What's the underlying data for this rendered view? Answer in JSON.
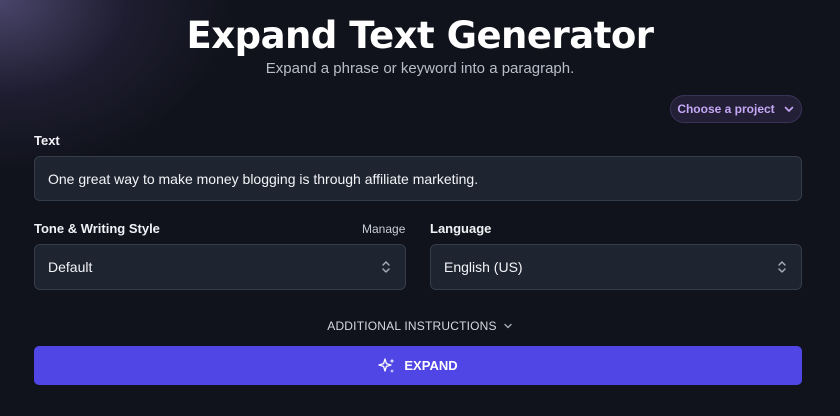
{
  "header": {
    "title": "Expand Text Generator",
    "subtitle": "Expand a phrase or keyword into a paragraph."
  },
  "project_selector": {
    "label": "Choose a project",
    "icon": "chevron-down-icon",
    "color": "#c4a8f5"
  },
  "text_field": {
    "label": "Text",
    "value": "One great way to make money blogging is through affiliate marketing."
  },
  "tone": {
    "label": "Tone & Writing Style",
    "manage_label": "Manage",
    "value": "Default"
  },
  "language": {
    "label": "Language",
    "value": "English (US)"
  },
  "additional_instructions": {
    "label": "ADDITIONAL INSTRUCTIONS",
    "icon": "chevron-down-icon"
  },
  "expand_button": {
    "label": "EXPAND",
    "icon": "sparkles-icon",
    "color": "#5046e5"
  }
}
